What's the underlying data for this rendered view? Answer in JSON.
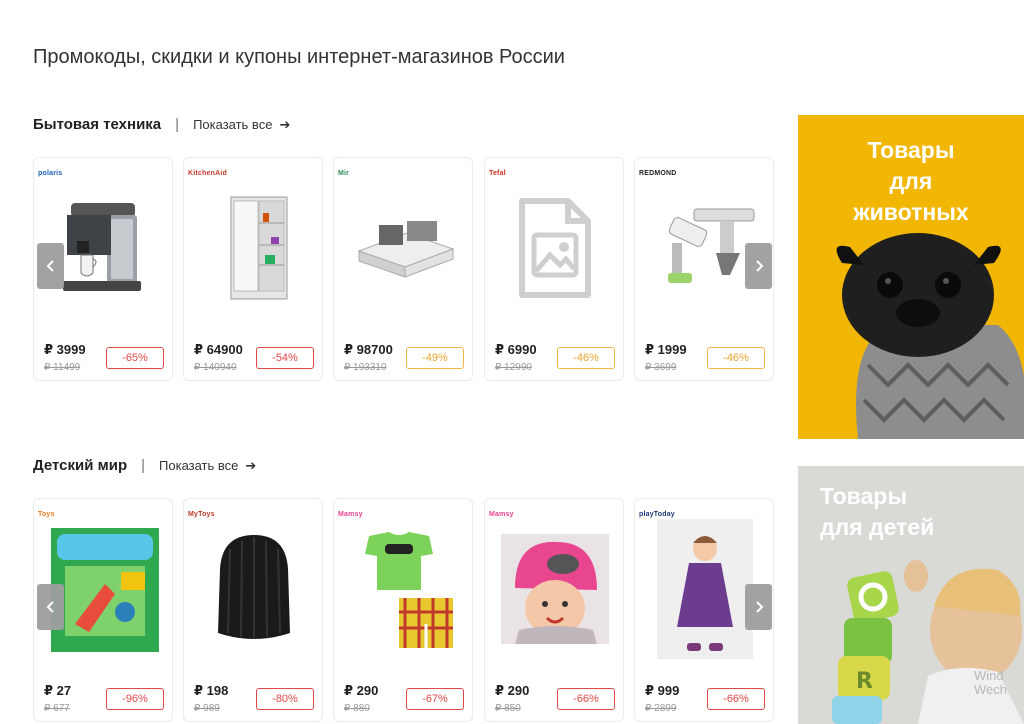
{
  "page": {
    "title": "Промокоды, скидки и купоны интернет-магазинов России"
  },
  "sections": [
    {
      "name": "Бытовая техника",
      "show_all": "Показать все",
      "products": [
        {
          "brand": "polaris",
          "price": "₽ 3999",
          "old_price": "₽ 11499",
          "discount": "-65%",
          "badge_color": "#e04848",
          "image": "espresso-machine"
        },
        {
          "brand": "KitchenAid",
          "price": "₽ 64900",
          "old_price": "₽ 140940",
          "discount": "-54%",
          "badge_color": "#e04848",
          "image": "refrigerator"
        },
        {
          "brand": "Mir",
          "price": "₽ 98700",
          "old_price": "₽ 193310",
          "discount": "-49%",
          "badge_color": "#f2b64a",
          "image": "cassette-air-conditioner"
        },
        {
          "brand": "Tefal",
          "price": "₽ 6990",
          "old_price": "₽ 12990",
          "discount": "-46%",
          "badge_color": "#f2b64a",
          "image": "image-placeholder"
        },
        {
          "brand": "REDMOND",
          "price": "₽ 1999",
          "old_price": "₽ 3699",
          "discount": "-46%",
          "badge_color": "#f2b64a",
          "image": "window-cleaner"
        }
      ]
    },
    {
      "name": "Детский мир",
      "show_all": "Показать все",
      "products": [
        {
          "brand": "Toys",
          "price": "₽ 27",
          "old_price": "₽ 677",
          "discount": "-96%",
          "badge_color": "#e04848",
          "image": "toy-box"
        },
        {
          "brand": "MyToys",
          "price": "₽ 198",
          "old_price": "₽ 989",
          "discount": "-80%",
          "badge_color": "#e04848",
          "image": "knit-hat"
        },
        {
          "brand": "Mamsy",
          "price": "₽ 290",
          "old_price": "₽ 880",
          "discount": "-67%",
          "badge_color": "#e04848",
          "image": "baby-outfit"
        },
        {
          "brand": "Mamsy",
          "price": "₽ 290",
          "old_price": "₽ 850",
          "discount": "-66%",
          "badge_color": "#e04848",
          "image": "child-in-hat"
        },
        {
          "brand": "playToday",
          "price": "₽ 999",
          "old_price": "₽ 2899",
          "discount": "-66%",
          "badge_color": "#e04848",
          "image": "girl-in-coat"
        }
      ]
    }
  ],
  "promos": [
    {
      "text_lines": [
        "Товары",
        "для",
        "животных"
      ],
      "background": "#f2b705",
      "image": "pug"
    },
    {
      "text_lines": [
        "Товары",
        "для детей"
      ],
      "background": "#dcdcdc",
      "image": "child-with-blocks"
    }
  ],
  "watermark": [
    "Wind",
    "Wech"
  ],
  "icons": {
    "prev": "chevron-left-icon",
    "next": "chevron-right-icon",
    "arrow": "arrow-right-icon"
  }
}
